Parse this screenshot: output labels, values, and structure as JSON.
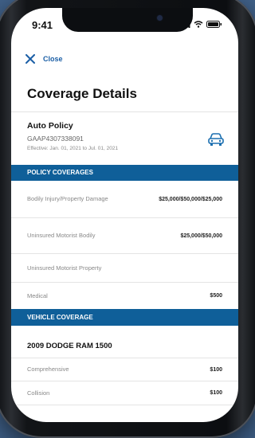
{
  "status_bar": {
    "time": "9:41"
  },
  "nav": {
    "close_label": "Close"
  },
  "page": {
    "title": "Coverage Details"
  },
  "policy": {
    "name": "Auto Policy",
    "number": "GAAP4307338091",
    "effective": "Effective: Jan. 01, 2021 to Jul. 01, 2021"
  },
  "policy_coverages": {
    "header": "POLICY COVERAGES",
    "rows": [
      {
        "label": "Bodily Injury/Property Damage",
        "value": "$25,000/$50,000/$25,000"
      },
      {
        "label": "Uninsured Motorist Bodily",
        "value": "$25,000/$50,000"
      },
      {
        "label": "Uninsured Motorist Property",
        "value": ""
      },
      {
        "label": "Medical",
        "value": "$500"
      }
    ]
  },
  "vehicle_coverage": {
    "header": "VEHICLE COVERAGE",
    "vehicle_name": "2009 DODGE RAM 1500",
    "rows": [
      {
        "label": "Comprehensive",
        "value": "$100"
      },
      {
        "label": "Collision",
        "value": "$100"
      }
    ]
  },
  "colors": {
    "accent": "#0f5f99",
    "link": "#1b5fa6"
  }
}
